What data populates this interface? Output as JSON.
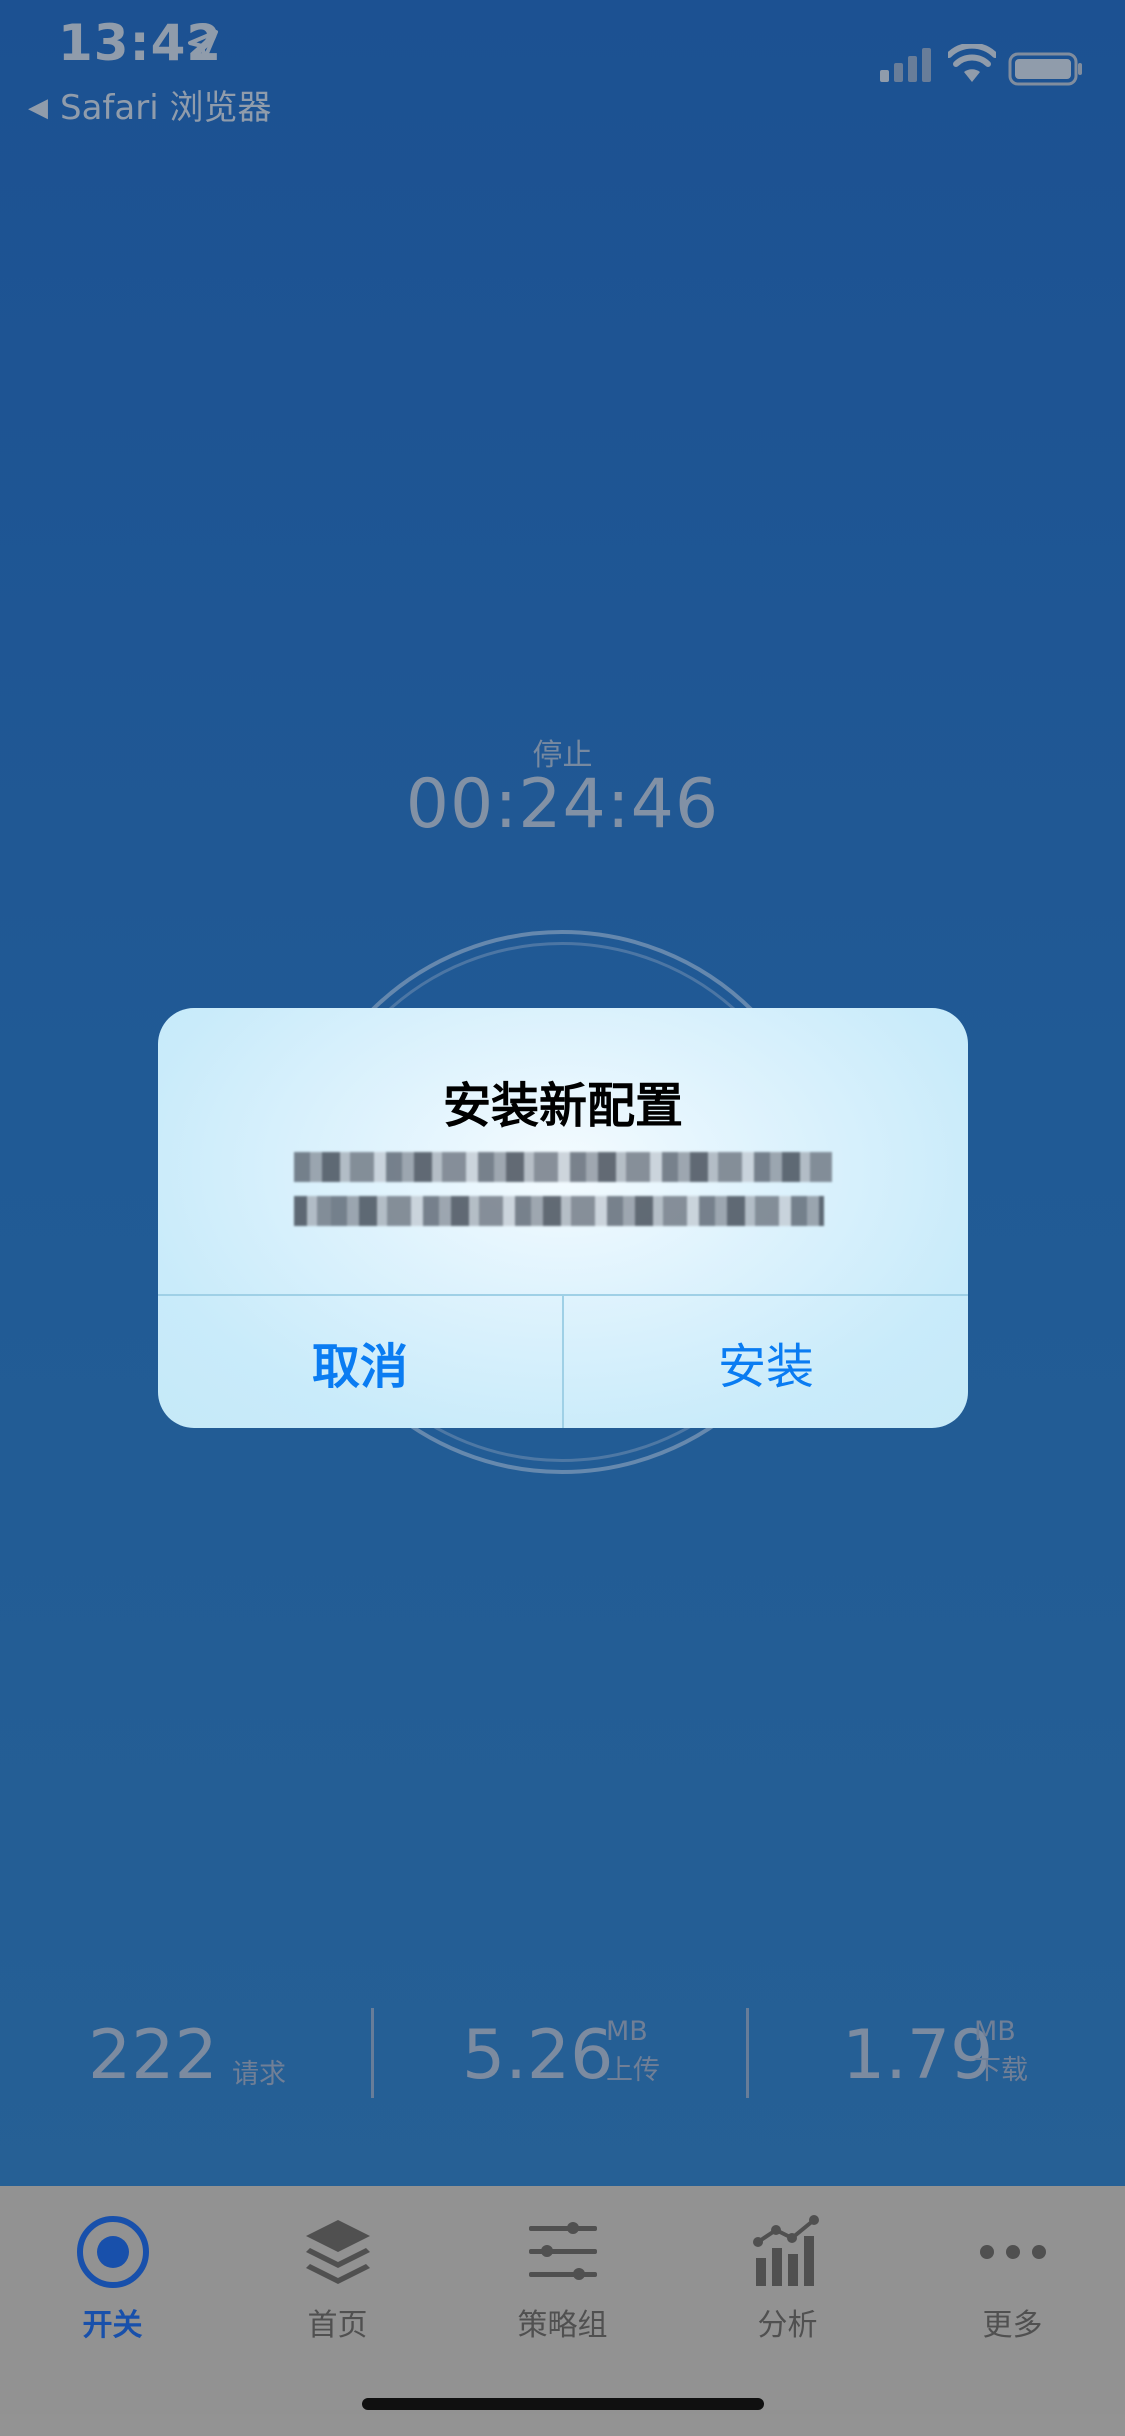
{
  "status_bar": {
    "time": "13:42",
    "back_app": "Safari 浏览器"
  },
  "timer": {
    "label": "停止",
    "value": "00:24:46"
  },
  "alert": {
    "title": "安装新配置",
    "cancel_label": "取消",
    "install_label": "安装"
  },
  "stats": {
    "requests_value": "222",
    "requests_label": "请求",
    "upload_value": "5.26",
    "upload_unit": "MB",
    "upload_label": "上传",
    "download_value": "1.79",
    "download_unit": "MB",
    "download_label": "下载"
  },
  "tabs": [
    {
      "label": "开关",
      "icon": "power-toggle-icon",
      "active": true
    },
    {
      "label": "首页",
      "icon": "layers-icon",
      "active": false
    },
    {
      "label": "策略组",
      "icon": "sliders-icon",
      "active": false
    },
    {
      "label": "分析",
      "icon": "chart-icon",
      "active": false
    },
    {
      "label": "更多",
      "icon": "more-icon",
      "active": false
    }
  ],
  "colors": {
    "background": "#1e579c",
    "alert_button": "#0a7cf2",
    "tab_active": "#1a55b6",
    "tabbar": "#9c9c9c"
  }
}
